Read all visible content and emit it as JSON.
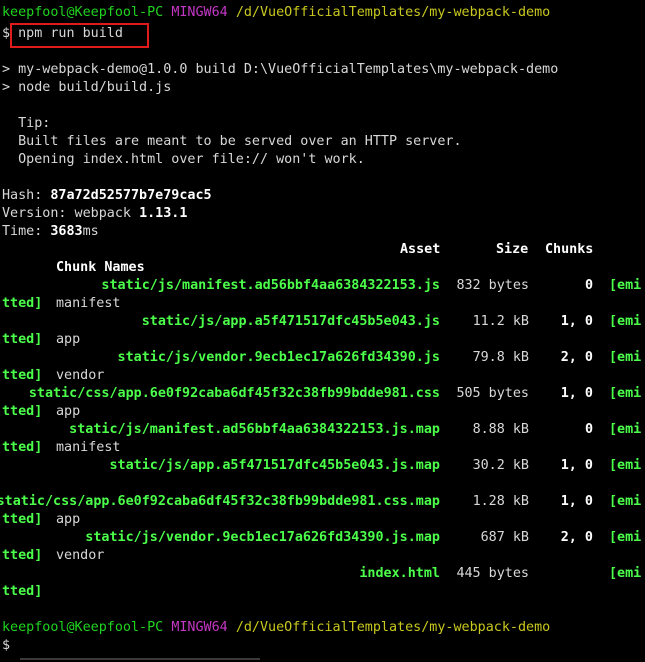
{
  "prompt1": {
    "user": "keepfool@Keepfool-PC",
    "env": "MINGW64",
    "path": "/d/VueOfficialTemplates/my-webpack-demo"
  },
  "cmd": {
    "dollar": "$",
    "text": "npm run build"
  },
  "run_lines": [
    "> my-webpack-demo@1.0.0 build D:\\VueOfficialTemplates\\my-webpack-demo",
    "> node build/build.js"
  ],
  "tip": {
    "title": "  Tip:",
    "line1": "  Built files are meant to be served over an HTTP server.",
    "line2": "  Opening index.html over file:// won't work."
  },
  "stats": {
    "hash_label": "Hash: ",
    "hash": "87a72d52577b7e79cac5",
    "version_label": "Version: webpack ",
    "version": "1.13.1",
    "time_label": "Time: ",
    "time": "3683",
    "time_unit": "ms"
  },
  "table": {
    "h_asset": "Asset",
    "h_size": "Size",
    "h_chunks": "Chunks",
    "h_names": "Chunk Names",
    "rows": [
      {
        "asset": "static/js/manifest.ad56bbf4aa6384322153.js",
        "size": "832 bytes",
        "chunks": "0",
        "emit1": "[emi",
        "emit2": "tted]",
        "name": "manifest"
      },
      {
        "asset": "static/js/app.a5f471517dfc45b5e043.js",
        "size": "11.2 kB",
        "chunks": "1, 0",
        "emit1": "[emi",
        "emit2": "tted]",
        "name": "app"
      },
      {
        "asset": "static/js/vendor.9ecb1ec17a626fd34390.js",
        "size": "79.8 kB",
        "chunks": "2, 0",
        "emit1": "[emi",
        "emit2": "tted]",
        "name": "vendor"
      },
      {
        "asset": "static/css/app.6e0f92caba6df45f32c38fb99bdde981.css",
        "size": "505 bytes",
        "chunks": "1, 0",
        "emit1": "[emi",
        "emit2": "tted]",
        "name": "app"
      },
      {
        "asset": "static/js/manifest.ad56bbf4aa6384322153.js.map",
        "size": "8.88 kB",
        "chunks": "0",
        "emit1": "[emi",
        "emit2": "tted]",
        "name": "manifest"
      },
      {
        "asset": "static/js/app.a5f471517dfc45b5e043.js.map",
        "size": "30.2 kB",
        "chunks": "1, 0",
        "emit1": "[emi",
        "emit2": "",
        "name": ""
      },
      {
        "asset": "static/css/app.6e0f92caba6df45f32c38fb99bdde981.css.map",
        "size": "1.28 kB",
        "chunks": "1, 0",
        "emit1": "[emi",
        "emit2": "tted]",
        "name": "app"
      },
      {
        "asset": "static/js/vendor.9ecb1ec17a626fd34390.js.map",
        "size": "687 kB",
        "chunks": "2, 0",
        "emit1": "[emi",
        "emit2": "tted]",
        "name": "vendor"
      },
      {
        "asset": "index.html",
        "size": "445 bytes",
        "chunks": "",
        "emit1": "[emi",
        "emit2": "tted]",
        "name": ""
      }
    ]
  },
  "prompt2": {
    "user": "keepfool@Keepfool-PC",
    "env": "MINGW64",
    "path": "/d/VueOfficialTemplates/my-webpack-demo"
  },
  "final_dollar": "$",
  "colors": {
    "green": "#1fd41f",
    "magenta": "#c437c4",
    "yellow": "#c8c81e",
    "highlight": "#e01b1b"
  }
}
